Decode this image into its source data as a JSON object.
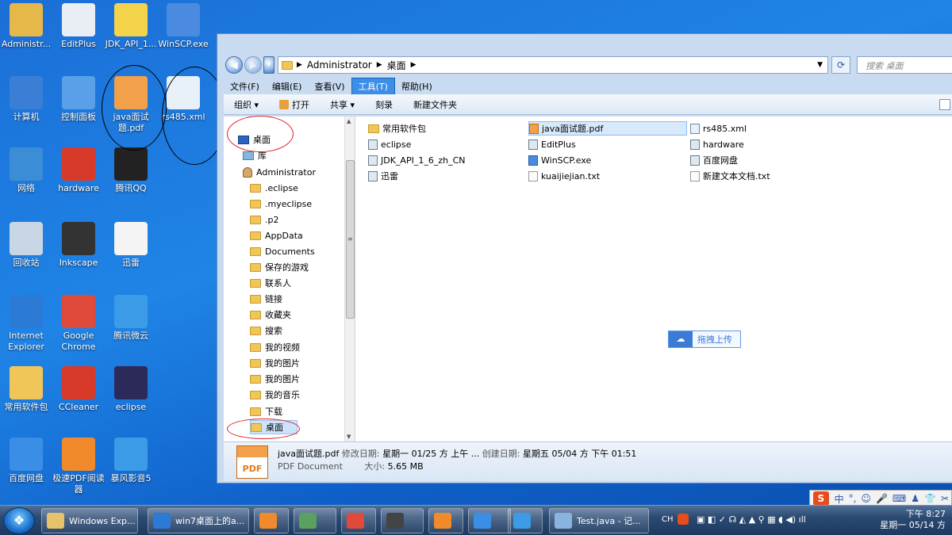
{
  "desktop": {
    "icons": [
      {
        "label": "Administr...",
        "icon": "user-folder-icon",
        "color": "#e6b84a"
      },
      {
        "label": "EditPlus",
        "icon": "editplus-icon",
        "color": "#e9eef5"
      },
      {
        "label": "JDK_API_1...",
        "icon": "help-doc-icon",
        "color": "#f3d34a"
      },
      {
        "label": "WinSCP.exe",
        "icon": "winscp-icon",
        "color": "#4a8be0"
      },
      {
        "label": "计算机",
        "icon": "computer-icon",
        "color": "#3b7ed6"
      },
      {
        "label": "控制面板",
        "icon": "control-panel-icon",
        "color": "#5aa0e8"
      },
      {
        "label": "java面试题.pdf",
        "icon": "pdf-icon",
        "color": "#f2a04a"
      },
      {
        "label": "rs485.xml",
        "icon": "xml-icon",
        "color": "#e8f0f8"
      },
      {
        "label": "网络",
        "icon": "network-icon",
        "color": "#3b8ed6"
      },
      {
        "label": "hardware",
        "icon": "hardware-icon",
        "color": "#d83a2a"
      },
      {
        "label": "腾讯QQ",
        "icon": "qq-icon",
        "color": "#222222"
      },
      {
        "label": "回收站",
        "icon": "recycle-bin-icon",
        "color": "#c9d6e4"
      },
      {
        "label": "Inkscape",
        "icon": "inkscape-icon",
        "color": "#333333"
      },
      {
        "label": "迅雷",
        "icon": "thunder-icon",
        "color": "#f4f4f4"
      },
      {
        "label": "Internet Explorer",
        "icon": "ie-icon",
        "color": "#2a7ad6"
      },
      {
        "label": "Google Chrome",
        "icon": "chrome-icon",
        "color": "#e04a3a"
      },
      {
        "label": "腾讯微云",
        "icon": "weiyun-icon",
        "color": "#3b9be6"
      },
      {
        "label": "常用软件包",
        "icon": "folder-icon",
        "color": "#f1c659"
      },
      {
        "label": "CCleaner",
        "icon": "ccleaner-icon",
        "color": "#d83a2a"
      },
      {
        "label": "eclipse",
        "icon": "eclipse-icon",
        "color": "#2c2a5a"
      },
      {
        "label": "百度网盘",
        "icon": "baidu-netdisk-icon",
        "color": "#3b8ee6"
      },
      {
        "label": "极速PDF阅读器",
        "icon": "pdf-reader-icon",
        "color": "#f08a2a"
      },
      {
        "label": "暴风影音5",
        "icon": "storm-player-icon",
        "color": "#3b9be6"
      }
    ]
  },
  "explorer": {
    "address": {
      "segments": [
        "Administrator",
        "桌面"
      ]
    },
    "search_placeholder": "搜索 桌面",
    "menu": [
      "文件(F)",
      "编辑(E)",
      "查看(V)",
      "工具(T)",
      "帮助(H)"
    ],
    "menu_active_index": 3,
    "toolbar": [
      "组织 ▾",
      "打开",
      "共享 ▾",
      "刻录",
      "新建文件夹"
    ],
    "nav": [
      {
        "label": "桌面",
        "type": "desktop"
      },
      {
        "label": "库",
        "type": "library"
      },
      {
        "label": "Administrator",
        "type": "user"
      },
      {
        "label": ".eclipse",
        "type": "folder"
      },
      {
        "label": ".myeclipse",
        "type": "folder"
      },
      {
        "label": ".p2",
        "type": "folder"
      },
      {
        "label": "AppData",
        "type": "folder"
      },
      {
        "label": "Documents",
        "type": "folder"
      },
      {
        "label": "保存的游戏",
        "type": "folder"
      },
      {
        "label": "联系人",
        "type": "folder"
      },
      {
        "label": "链接",
        "type": "folder"
      },
      {
        "label": "收藏夹",
        "type": "folder"
      },
      {
        "label": "搜索",
        "type": "folder"
      },
      {
        "label": "我的视频",
        "type": "folder"
      },
      {
        "label": "我的图片",
        "type": "folder"
      },
      {
        "label": "我的图片",
        "type": "folder"
      },
      {
        "label": "我的音乐",
        "type": "folder"
      },
      {
        "label": "下载",
        "type": "folder"
      },
      {
        "label": "桌面",
        "type": "folder",
        "selected": true
      }
    ],
    "files": [
      {
        "name": "常用软件包",
        "type": "folder"
      },
      {
        "name": "java面试题.pdf",
        "type": "pdf",
        "selected": true
      },
      {
        "name": "rs485.xml",
        "type": "xml"
      },
      {
        "name": "eclipse",
        "type": "link"
      },
      {
        "name": "EditPlus",
        "type": "link"
      },
      {
        "name": "hardware",
        "type": "link"
      },
      {
        "name": "JDK_API_1_6_zh_CN",
        "type": "link"
      },
      {
        "name": "WinSCP.exe",
        "type": "exe"
      },
      {
        "name": "百度网盘",
        "type": "link"
      },
      {
        "name": "迅雷",
        "type": "link"
      },
      {
        "name": "kuaijiejian.txt",
        "type": "txt"
      },
      {
        "name": "新建文本文档.txt",
        "type": "txt"
      }
    ],
    "upload_button": "拖拽上传",
    "details": {
      "name": "java面试题.pdf",
      "modified_label": "修改日期:",
      "modified": "星期一 01/25 方 上午 ...",
      "created_label": "创建日期:",
      "created": "星期五 05/04 方 下午 01:51",
      "type": "PDF Document",
      "size_label": "大小:",
      "size": "5.65 MB",
      "icon_text": "PDF"
    }
  },
  "taskbar": {
    "tasks": [
      {
        "label": "Windows Exp...",
        "icon": "explorer-icon",
        "color": "#e6c36a"
      },
      {
        "label": "win7桌面上的a...",
        "icon": "ie-icon",
        "color": "#2a7ad6"
      },
      {
        "label": "",
        "icon": "media-icon",
        "color": "#f08a2a"
      },
      {
        "label": "",
        "icon": "app-icon",
        "color": "#5aa060"
      },
      {
        "label": "",
        "icon": "chrome-icon",
        "color": "#e04a3a"
      },
      {
        "label": "",
        "icon": "keyboard-icon",
        "color": "#444444"
      },
      {
        "label": "",
        "icon": "pdf-reader-icon",
        "color": "#f08a2a"
      },
      {
        "label": "",
        "icon": "baidu-netdisk-icon",
        "color": "#3b8ee6"
      },
      {
        "label": "",
        "icon": "storm-player-icon",
        "color": "#3b9be6"
      },
      {
        "label": "Test.java - 记...",
        "icon": "notepad-icon",
        "color": "#8ab4e0"
      }
    ],
    "tray_lang": "CH",
    "clock_time": "下午 8:27",
    "clock_date": "星期一 05/14 方"
  },
  "ime": {
    "logo": "S",
    "mode": "中",
    "punct": "°,"
  }
}
